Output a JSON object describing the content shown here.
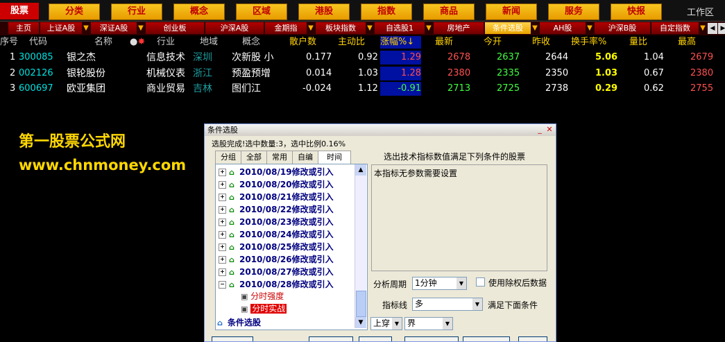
{
  "topnav": {
    "active_tab": "股票",
    "buttons": [
      "分类",
      "行业",
      "概念",
      "区域",
      "港股",
      "指数",
      "商品",
      "新闻",
      "服务",
      "快报"
    ],
    "workarea": "工作区"
  },
  "subtabs": {
    "items": [
      "主页",
      "上证A股",
      "深证A股",
      "创业板",
      "沪深A股",
      "金期指",
      "板块指数",
      "自选股1",
      "房地产",
      "条件选股",
      "AH股",
      "沪深B股",
      "自定指数"
    ],
    "selected": "条件选股",
    "scroll_left": "◀",
    "scroll_right": "▶"
  },
  "table": {
    "columns": [
      "序号",
      "代码",
      "名称",
      "●",
      "行业",
      "地域",
      "概念",
      "散户数",
      "主动比",
      "涨幅%↓",
      "最新",
      "今开",
      "昨收",
      "换手率%",
      "量比",
      "最高"
    ],
    "rows": [
      {
        "idx": "1",
        "code": "300085",
        "name": "银之杰",
        "industry": "信息技术",
        "region": "深圳",
        "concept": "次新股 小",
        "retail": "0.177",
        "active": "0.92",
        "chg": "1.29",
        "latest": "2678",
        "open": "2637",
        "prev": "2644",
        "turnover": "5.06",
        "vol_ratio": "1.04",
        "high": "2679"
      },
      {
        "idx": "2",
        "code": "002126",
        "name": "银轮股份",
        "industry": "机械仪表",
        "region": "浙江",
        "concept": "预盈预增",
        "retail": "0.014",
        "active": "1.03",
        "chg": "1.28",
        "latest": "2380",
        "open": "2335",
        "prev": "2350",
        "turnover": "1.03",
        "vol_ratio": "0.67",
        "high": "2380"
      },
      {
        "idx": "3",
        "code": "600697",
        "name": "欧亚集团",
        "industry": "商业贸易",
        "region": "吉林",
        "concept": "图们江",
        "retail": "-0.024",
        "active": "1.12",
        "chg": "-0.91",
        "latest": "2713",
        "open": "2725",
        "prev": "2738",
        "turnover": "0.29",
        "vol_ratio": "0.62",
        "high": "2755"
      }
    ]
  },
  "watermark": {
    "line1": "第一股票公式网",
    "line2": "www.chnmoney.com"
  },
  "dialog": {
    "title": "条件选股",
    "status": "选股完成!选中数量:3，选中比例0.16%",
    "tabs": [
      "分组",
      "全部",
      "常用",
      "自编",
      "时间"
    ],
    "active_tab": "时间",
    "tree_dates": [
      "2010/08/19修改或引入",
      "2010/08/20修改或引入",
      "2010/08/21修改或引入",
      "2010/08/22修改或引入",
      "2010/08/23修改或引入",
      "2010/08/24修改或引入",
      "2010/08/25修改或引入",
      "2010/08/26修改或引入",
      "2010/08/27修改或引入",
      "2010/08/28修改或引入"
    ],
    "leaf1": "分时强度",
    "leaf2": "分时实战",
    "root": "条件选股",
    "description": "选出技术指标数值满足下列条件的股票",
    "param_text": "本指标无参数需要设置",
    "period_label": "分析周期",
    "period_value": "1分钟",
    "checkbox_label": "使用除权后数据",
    "line_label": "指标线",
    "line_value": "多",
    "cond_suffix": "满足下面条件",
    "cond_op": "上穿",
    "cond_val": "界"
  }
}
